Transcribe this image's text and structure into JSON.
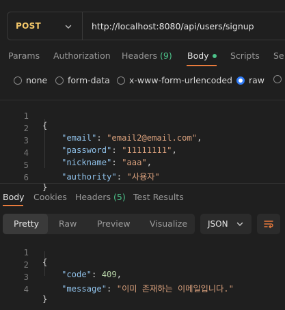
{
  "request": {
    "method": "POST",
    "url": "http://localhost:8080/api/users/signup"
  },
  "request_tabs": {
    "params": "Params",
    "authorization": "Authorization",
    "headers": "Headers",
    "headers_count": "(9)",
    "body": "Body",
    "scripts": "Scripts",
    "settings_partial": "Se"
  },
  "body_types": {
    "none": "none",
    "form_data": "form-data",
    "urlencoded": "x-www-form-urlencoded",
    "raw": "raw",
    "selected": "raw"
  },
  "request_body": {
    "line_numbers": [
      "1",
      "2",
      "3",
      "4",
      "5",
      "6"
    ],
    "open_brace": "{",
    "close_brace": "}",
    "fields": [
      {
        "key": "\"email\"",
        "value": "\"email2@email.com\"",
        "trail": ","
      },
      {
        "key": "\"password\"",
        "value": "\"11111111\"",
        "trail": ","
      },
      {
        "key": "\"nickname\"",
        "value": "\"aaa\"",
        "trail": ","
      },
      {
        "key": "\"authority\"",
        "value": "\"사용자\"",
        "trail": ""
      }
    ]
  },
  "response_tabs": {
    "body": "Body",
    "cookies": "Cookies",
    "headers": "Headers",
    "headers_count": "(5)",
    "test_results": "Test Results"
  },
  "response_toolbar": {
    "pretty": "Pretty",
    "raw": "Raw",
    "preview": "Preview",
    "visualize": "Visualize",
    "format": "JSON"
  },
  "response_body": {
    "line_numbers": [
      "1",
      "2",
      "3",
      "4"
    ],
    "open_brace": "{",
    "close_brace": "}",
    "code_key": "\"code\"",
    "code_value": "409",
    "message_key": "\"message\"",
    "message_value": "\"이미 존재하는 이메일입니다.\""
  },
  "colors": {
    "background": "#1f1f1f",
    "method": "#f4c86a",
    "accent": "#e97b3c",
    "green": "#4cc38a",
    "radio_selected": "#2f7bf6",
    "json_key": "#8fc0e8",
    "json_string": "#d9a07c",
    "json_number": "#b7d3a8"
  },
  "icons": {
    "method_dropdown": "chevron-down-icon",
    "format_dropdown": "chevron-down-icon",
    "wrap": "text-wrap-icon"
  }
}
